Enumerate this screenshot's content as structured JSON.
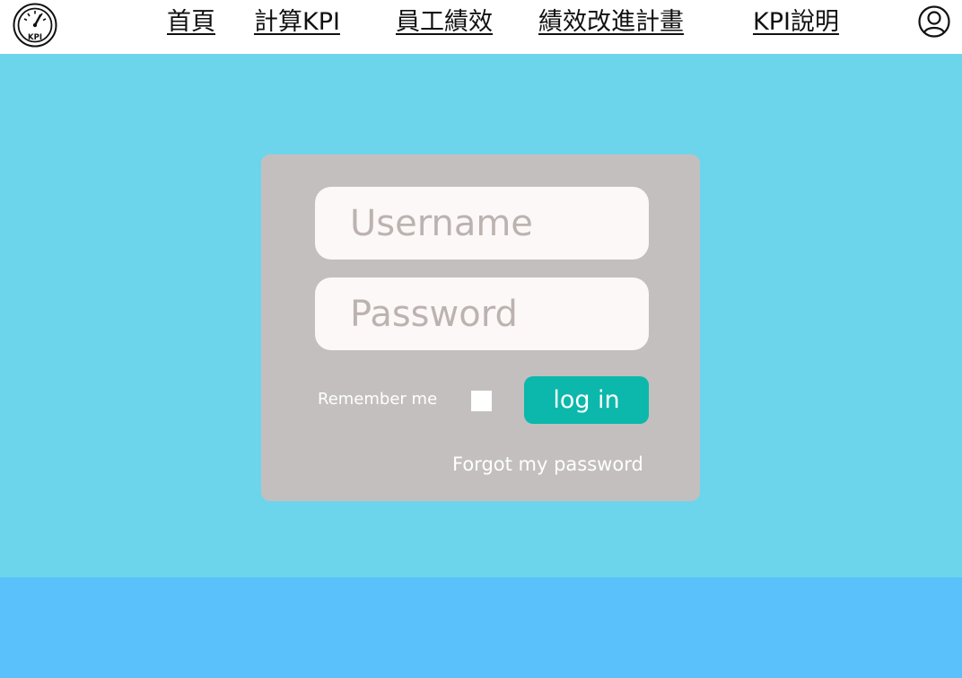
{
  "header": {
    "logo_text": "KPI",
    "nav": [
      {
        "label": "首頁"
      },
      {
        "label": "計算KPI"
      },
      {
        "label": "員工績效"
      },
      {
        "label": "績效改進計畫"
      },
      {
        "label": "KPI說明"
      }
    ],
    "user_icon": "user-circle-icon"
  },
  "login": {
    "username_placeholder": "Username",
    "password_placeholder": "Password",
    "remember_label": "Remember me",
    "remember_checked": false,
    "login_label": "log in",
    "forgot_label": "Forgot my password"
  },
  "colors": {
    "hero_background": "#6dd5eb",
    "footer_background": "#5bc1fb",
    "card_background": "#c4bfbf",
    "login_button": "#0bb8ab"
  }
}
